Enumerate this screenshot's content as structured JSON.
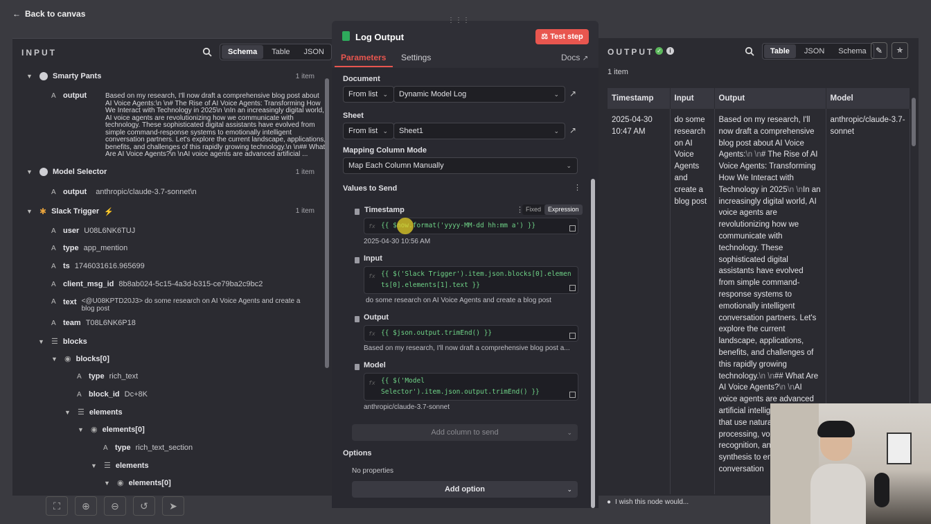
{
  "top": {
    "back_label": "Back to canvas"
  },
  "input_panel": {
    "title": "INPUT",
    "tabs": [
      "Schema",
      "Table",
      "JSON"
    ],
    "active_tab": "Schema",
    "nodes": [
      {
        "name": "Smarty Pants",
        "count": "1 item",
        "field_key": "output",
        "field_value": "Based on my research, I'll now draft a comprehensive blog post about AI Voice Agents:\\n \\n# The Rise of AI Voice Agents: Transforming How We Interact with Technology in 2025\\n \\nIn an increasingly digital world, AI voice agents are revolutionizing how we communicate with technology. These sophisticated digital assistants have evolved from simple command-response systems to emotionally intelligent conversation partners. Let's explore the current landscape, applications, benefits, and challenges of this rapidly growing technology.\\n \\n## What Are AI Voice Agents?\\n \\nAI voice agents are advanced artificial ..."
      },
      {
        "name": "Model Selector",
        "count": "1 item",
        "field_key": "output",
        "field_value": "anthropic/claude-3.7-sonnet\\n"
      },
      {
        "name": "Slack Trigger",
        "count": "1 item"
      }
    ],
    "slack_fields": [
      {
        "key": "user",
        "value": "U08L6NK6TUJ"
      },
      {
        "key": "type",
        "value": "app_mention"
      },
      {
        "key": "ts",
        "value": "1746031616.965699"
      },
      {
        "key": "client_msg_id",
        "value": "8b8ab024-5c15-4a3d-b315-ce79ba2c9bc2"
      },
      {
        "key": "text",
        "value": "<@U08KPTD20J3> do some research on AI Voice Agents and create a blog post"
      },
      {
        "key": "team",
        "value": "T08L6NK6P18"
      }
    ],
    "tree": [
      {
        "key": "blocks"
      },
      {
        "key": "blocks[0]"
      },
      {
        "key": "type",
        "value": "rich_text"
      },
      {
        "key": "block_id",
        "value": "Dc+8K"
      },
      {
        "key": "elements"
      },
      {
        "key": "elements[0]"
      },
      {
        "key": "type",
        "value": "rich_text_section"
      },
      {
        "key": "elements"
      },
      {
        "key": "elements[0]"
      }
    ]
  },
  "modal": {
    "title": "Log Output",
    "test_button": "Test step",
    "tabs": [
      "Parameters",
      "Settings"
    ],
    "docs": "Docs",
    "document_label": "Document",
    "document_mode": "From list",
    "document_value": "Dynamic Model Log",
    "sheet_label": "Sheet",
    "sheet_mode": "From list",
    "sheet_value": "Sheet1",
    "mapping_label": "Mapping Column Mode",
    "mapping_value": "Map Each Column Manually",
    "values_label": "Values to Send",
    "fixed": "Fixed",
    "expression": "Expression",
    "fields": [
      {
        "name": "Timestamp",
        "expr": "{{ $now.format('yyyy-MM-dd hh:mm a') }}",
        "result": "2025-04-30 10:56 AM"
      },
      {
        "name": "Input",
        "expr": "{{ $('Slack Trigger').item.json.blocks[0].elements[0].elements[1].text }}",
        "result": "do some research on AI Voice Agents and create a blog post"
      },
      {
        "name": "Output",
        "expr": "{{ $json.output.trimEnd() }}",
        "result": "Based on my research, I'll now draft a comprehensive blog post a..."
      },
      {
        "name": "Model",
        "expr": "{{ $('Model Selector').item.json.output.trimEnd() }}",
        "result": "anthropic/claude-3.7-sonnet"
      }
    ],
    "add_column": "Add column to send",
    "options_label": "Options",
    "no_properties": "No properties",
    "add_option": "Add option"
  },
  "output_panel": {
    "title": "OUTPUT",
    "tabs": [
      "Table",
      "JSON",
      "Schema"
    ],
    "active_tab": "Table",
    "items": "1 item",
    "columns": [
      "Timestamp",
      "Input",
      "Output",
      "Model"
    ],
    "row": {
      "timestamp": "2025-04-30 10:47 AM",
      "input": "do some research on AI Voice Agents and create a blog post",
      "output_parts": [
        "Based on my research, I'll now draft a comprehensive blog post about AI Voice Agents:",
        "\\n \\n",
        "# The Rise of AI Voice Agents: Transforming How We Interact with Technology in 2025",
        "\\n \\n",
        "In an increasingly digital world, AI voice agents are revolutionizing how we communicate with technology. These sophisticated digital assistants have evolved from simple command-response systems to emotionally intelligent conversation partners. Let's explore the current landscape, applications, benefits, and challenges of this rapidly growing technology.",
        "\\n \\n",
        "## What Are AI Voice Agents?",
        "\\n \\n",
        "AI voice agents are advanced artificial intelligence systems that use natural language processing, voice recognition, and speech synthesis to enable like conversation"
      ],
      "model": "anthropic/claude-3.7-sonnet"
    },
    "feedback": "I wish this node would..."
  },
  "colors": {
    "accent": "#e8564f",
    "expression": "#6fd387",
    "success": "#5cb85c"
  }
}
